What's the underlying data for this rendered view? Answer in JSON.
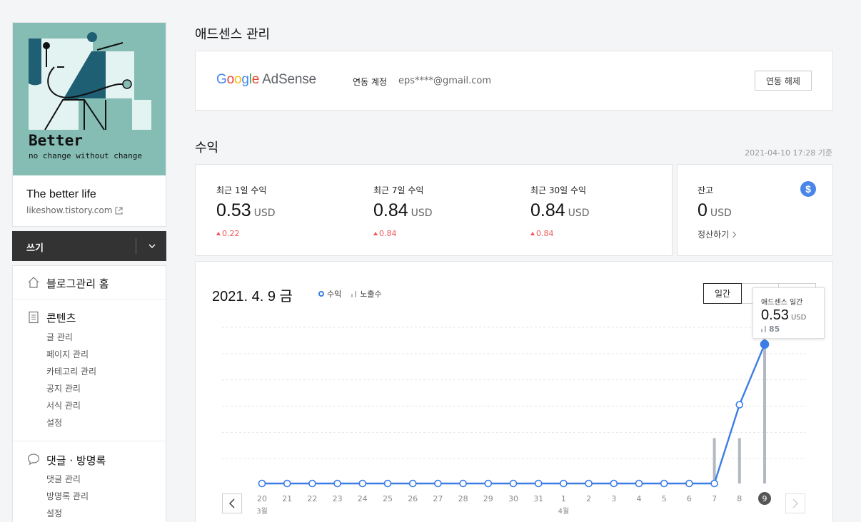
{
  "profile": {
    "art_title": "Better",
    "art_subtitle": "no change without change",
    "blog_title": "The better life",
    "blog_url": "likeshow.tistory.com"
  },
  "sidebar": {
    "write_label": "쓰기",
    "home_label": "블로그관리 홈",
    "sections": [
      {
        "title": "콘텐츠",
        "items": [
          "글 관리",
          "페이지 관리",
          "카테고리 관리",
          "공지 관리",
          "서식 관리",
          "설정"
        ]
      },
      {
        "title": "댓글 · 방명록",
        "items": [
          "댓글 관리",
          "방명록 관리",
          "설정"
        ]
      }
    ]
  },
  "main": {
    "title": "애드센스 관리",
    "adsense": {
      "logo_letters": [
        "G",
        "o",
        "o",
        "g",
        "l",
        "e"
      ],
      "logo_product": "AdSense",
      "linked_label": "연동 계정",
      "linked_value": "eps****@gmail.com",
      "unlink_label": "연동 해제"
    },
    "revenue_title": "수익",
    "timestamp": "2021-04-10 17:28 기준",
    "stats": [
      {
        "label": "최근 1일 수익",
        "value": "0.53",
        "unit": "USD",
        "delta": "0.22"
      },
      {
        "label": "최근 7일 수익",
        "value": "0.84",
        "unit": "USD",
        "delta": "0.84"
      },
      {
        "label": "최근 30일 수익",
        "value": "0.84",
        "unit": "USD",
        "delta": "0.84"
      }
    ],
    "balance": {
      "label": "잔고",
      "value": "0",
      "unit": "USD",
      "link": "정산하기"
    },
    "chart": {
      "date": "2021. 4. 9 금",
      "legend_revenue": "수익",
      "legend_impressions": "노출수",
      "tabs": [
        "일간",
        "",
        ""
      ],
      "active_tab": "일간"
    },
    "tooltip": {
      "title": "애드센스 일간",
      "value": "0.53",
      "unit": "USD",
      "impressions": "85"
    }
  },
  "colors": {
    "line": "#3b7de6",
    "bar": "#b3b9c2",
    "delta": "#f05555",
    "accent_badge": "#4a86e8"
  },
  "chart_data": {
    "type": "line",
    "x": [
      "20",
      "21",
      "22",
      "23",
      "24",
      "25",
      "26",
      "27",
      "28",
      "29",
      "30",
      "31",
      "1",
      "2",
      "3",
      "4",
      "5",
      "6",
      "7",
      "8",
      "9"
    ],
    "month_labels": [
      {
        "at": "20",
        "label": "3월"
      },
      {
        "at": "1",
        "label": "4월"
      }
    ],
    "selected_x": "9",
    "series": [
      {
        "name": "수익",
        "values": [
          0,
          0,
          0,
          0,
          0,
          0,
          0,
          0,
          0,
          0,
          0,
          0,
          0,
          0,
          0,
          0,
          0,
          0,
          0,
          0.3,
          0.53
        ]
      },
      {
        "name": "노출수",
        "values": [
          0,
          0,
          0,
          0,
          0,
          0,
          0,
          0,
          0,
          0,
          0,
          0,
          0,
          0,
          0,
          0,
          0,
          0,
          38,
          38,
          124
        ]
      }
    ],
    "ylim_revenue": [
      0,
      0.6
    ],
    "ylim_impressions": [
      0,
      132
    ],
    "grid": true
  }
}
